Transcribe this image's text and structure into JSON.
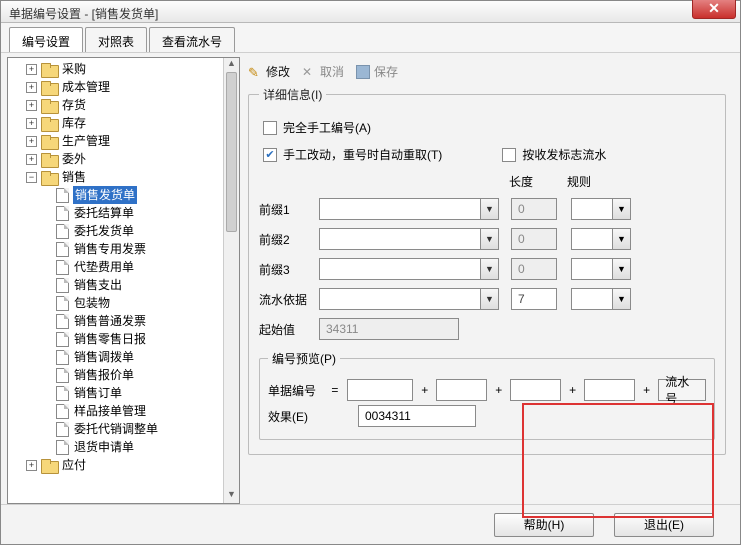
{
  "window": {
    "title": "单据编号设置 - [销售发货单]"
  },
  "tabs": [
    {
      "label": "编号设置",
      "active": true
    },
    {
      "label": "对照表"
    },
    {
      "label": "查看流水号"
    }
  ],
  "tree": {
    "top": [
      {
        "label": "采购",
        "expander": "+"
      },
      {
        "label": "成本管理",
        "expander": "+"
      },
      {
        "label": "存货",
        "expander": "+"
      },
      {
        "label": "库存",
        "expander": "+"
      },
      {
        "label": "生产管理",
        "expander": "+"
      },
      {
        "label": "委外",
        "expander": "+"
      }
    ],
    "sales": {
      "label": "销售",
      "expander": "−"
    },
    "sales_children": [
      {
        "label": "销售发货单",
        "selected": true
      },
      {
        "label": "委托结算单"
      },
      {
        "label": "委托发货单"
      },
      {
        "label": "销售专用发票"
      },
      {
        "label": "代垫费用单"
      },
      {
        "label": "销售支出"
      },
      {
        "label": "包装物"
      },
      {
        "label": "销售普通发票"
      },
      {
        "label": "销售零售日报"
      },
      {
        "label": "销售调拨单"
      },
      {
        "label": "销售报价单"
      },
      {
        "label": "销售订单"
      },
      {
        "label": "样品接单管理"
      },
      {
        "label": "委托代销调整单"
      },
      {
        "label": "退货申请单"
      }
    ],
    "last": {
      "label": "应付",
      "expander": "+"
    }
  },
  "toolbar": {
    "modify": "修改",
    "cancel": "取消",
    "save": "保存"
  },
  "detail": {
    "legend": "详细信息(I)",
    "manual_label": "完全手工编号(A)",
    "manual_checked": false,
    "auto_label": "手工改动，重号时自动重取(T)",
    "auto_checked": true,
    "byflag_label": "按收发标志流水",
    "byflag_checked": false,
    "head_length": "长度",
    "head_rule": "规则",
    "rows": [
      {
        "label": "前缀1",
        "len": "0"
      },
      {
        "label": "前缀2",
        "len": "0"
      },
      {
        "label": "前缀3",
        "len": "0"
      }
    ],
    "serial_basis": {
      "label": "流水依据",
      "len": "7"
    },
    "start": {
      "label": "起始值",
      "value": "34311"
    }
  },
  "preview": {
    "legend": "编号预览(P)",
    "row1_label": "单据编号",
    "eq": "=",
    "serial_word": "流水号",
    "row2_label": "效果(E)",
    "result": "0034311"
  },
  "footer": {
    "help": "帮助(H)",
    "exit": "退出(E)"
  }
}
